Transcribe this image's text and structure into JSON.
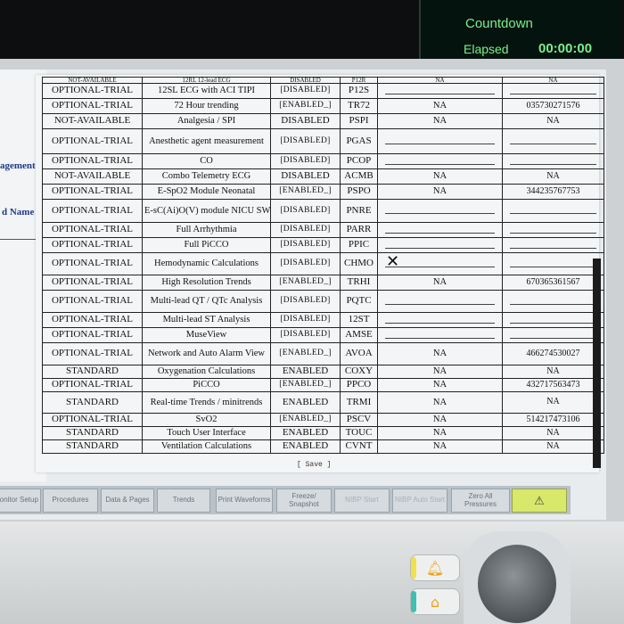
{
  "timer": {
    "countdown_label": "Countdown",
    "elapsed_label": "Elapsed",
    "elapsed_value": "00:00:00"
  },
  "side_panel": {
    "label_management": "agement",
    "label_name": "d Name"
  },
  "options_table": {
    "truncated_top_row": [
      "NOT-AVAILABLE",
      "12RL 12-lead ECG",
      "DISABLED",
      "P12R",
      "NA",
      "NA"
    ],
    "rows": [
      {
        "status": "OPTIONAL-TRIAL",
        "function": "12SL ECG with ACI TIPI",
        "state": "[DISABLED]",
        "code": "P12S",
        "trial": "",
        "serial": ""
      },
      {
        "status": "OPTIONAL-TRIAL",
        "function": "72 Hour trending",
        "state": "[ENABLED_]",
        "code": "TR72",
        "trial": "NA",
        "serial": "035730271576"
      },
      {
        "status": "NOT-AVAILABLE",
        "function": "Analgesia / SPI",
        "state": "DISABLED",
        "code": "PSPI",
        "trial": "NA",
        "serial": "NA"
      },
      {
        "status": "OPTIONAL-TRIAL",
        "function": "Anesthetic agent measurement",
        "state": "[DISABLED]",
        "code": "PGAS",
        "trial": "",
        "serial": ""
      },
      {
        "status": "OPTIONAL-TRIAL",
        "function": "CO",
        "state": "[DISABLED]",
        "code": "PCOP",
        "trial": "",
        "serial": ""
      },
      {
        "status": "NOT-AVAILABLE",
        "function": "Combo Telemetry ECG",
        "state": "DISABLED",
        "code": "ACMB",
        "trial": "NA",
        "serial": "NA"
      },
      {
        "status": "OPTIONAL-TRIAL",
        "function": "E-SpO2 Module Neonatal",
        "state": "[ENABLED_]",
        "code": "PSPO",
        "trial": "NA",
        "serial": "344235767753"
      },
      {
        "status": "OPTIONAL-TRIAL",
        "function": "E-sC(Ai)O(V) module NICU SW",
        "state": "[DISABLED]",
        "code": "PNRE",
        "trial": "",
        "serial": ""
      },
      {
        "status": "OPTIONAL-TRIAL",
        "function": "Full Arrhythmia",
        "state": "[DISABLED]",
        "code": "PARR",
        "trial": "",
        "serial": ""
      },
      {
        "status": "OPTIONAL-TRIAL",
        "function": "Full PiCCO",
        "state": "[DISABLED]",
        "code": "PPIC",
        "trial": "",
        "serial": ""
      },
      {
        "status": "OPTIONAL-TRIAL",
        "function": "Hemodynamic Calculations",
        "state": "[DISABLED]",
        "code": "CHMO",
        "trial": "",
        "serial": ""
      },
      {
        "status": "OPTIONAL-TRIAL",
        "function": "High Resolution Trends",
        "state": "[ENABLED_]",
        "code": "TRHI",
        "trial": "NA",
        "serial": "670365361567"
      },
      {
        "status": "OPTIONAL-TRIAL",
        "function": "Multi-lead QT / QTc Analysis",
        "state": "[DISABLED]",
        "code": "PQTC",
        "trial": "",
        "serial": ""
      },
      {
        "status": "OPTIONAL-TRIAL",
        "function": "Multi-lead ST Analysis",
        "state": "[DISABLED]",
        "code": "12ST",
        "trial": "",
        "serial": ""
      },
      {
        "status": "OPTIONAL-TRIAL",
        "function": "MuseView",
        "state": "[DISABLED]",
        "code": "AMSE",
        "trial": "",
        "serial": ""
      },
      {
        "status": "OPTIONAL-TRIAL",
        "function": "Network and Auto Alarm View",
        "state": "[ENABLED_]",
        "code": "AVOA",
        "trial": "NA",
        "serial": "466274530027"
      },
      {
        "status": "STANDARD",
        "function": "Oxygenation Calculations",
        "state": "ENABLED",
        "code": "COXY",
        "trial": "NA",
        "serial": "NA"
      },
      {
        "status": "OPTIONAL-TRIAL",
        "function": "PiCCO",
        "state": "[ENABLED_]",
        "code": "PPCO",
        "trial": "NA",
        "serial": "432717563473"
      },
      {
        "status": "STANDARD",
        "function": "Real-time Trends / minitrends",
        "state": "ENABLED",
        "code": "TRMI",
        "trial": "NA",
        "serial": "NA"
      },
      {
        "status": "OPTIONAL-TRIAL",
        "function": "SvO2",
        "state": "[ENABLED_]",
        "code": "PSCV",
        "trial": "NA",
        "serial": "514217473106"
      },
      {
        "status": "STANDARD",
        "function": "Touch User Interface",
        "state": "ENABLED",
        "code": "TOUC",
        "trial": "NA",
        "serial": "NA"
      },
      {
        "status": "STANDARD",
        "function": "Ventilation Calculations",
        "state": "ENABLED",
        "code": "CVNT",
        "trial": "NA",
        "serial": "NA"
      }
    ]
  },
  "save_label": "[ Save ]",
  "soft_keys": [
    {
      "label": "Monitor Setup"
    },
    {
      "label": "Procedures"
    },
    {
      "label": "Data & Pages"
    },
    {
      "label": "Trends"
    },
    {
      "label": "Print Waveforms"
    },
    {
      "label": "Freeze/ Snapshot"
    },
    {
      "label": "NIBP Start"
    },
    {
      "label": "NIBP Auto Start"
    },
    {
      "label": "Zero All Pressures"
    },
    {
      "label": "alarm-bell-icon"
    }
  ],
  "colors": {
    "timer_text": "#7af08a",
    "side_label": "#1f3a8a",
    "alarm_key": "#d7e86a",
    "hw_glyph": "#f2a012",
    "accent_yellow": "#f1e04a",
    "accent_teal": "#3fbfb0"
  },
  "icons": {
    "alarm_key_icon": "alarm-bell-icon",
    "hw_alarm_icon": "alarm-bell-icon",
    "hw_home_icon": "home-icon",
    "pointer_icon": "x-cursor-icon"
  }
}
